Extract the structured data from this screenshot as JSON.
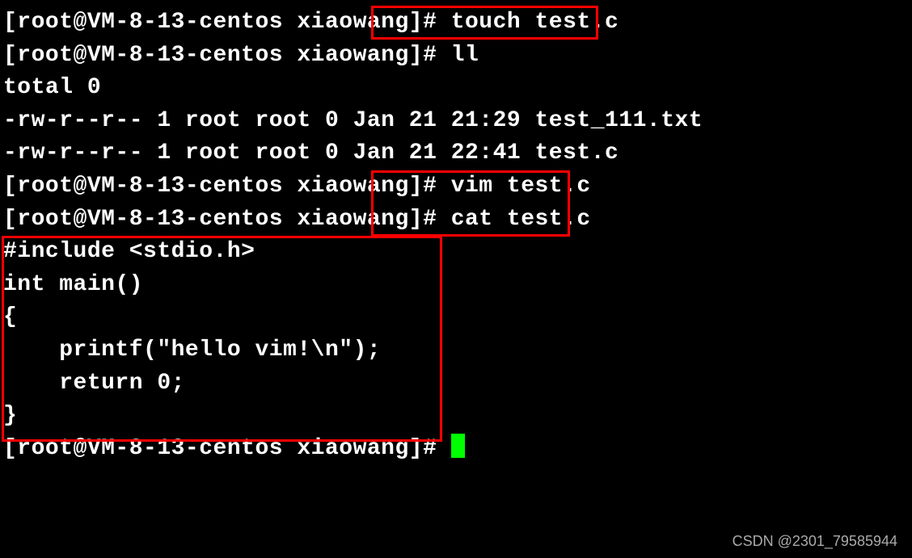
{
  "lines": {
    "l1_prompt": "[root@VM-8-13-centos xiaowang]# ",
    "l1_cmd": "touch test.c",
    "l2_prompt": "[root@VM-8-13-centos xiaowang]# ",
    "l2_cmd": "ll",
    "l3": "total 0",
    "l4": "-rw-r--r-- 1 root root 0 Jan 21 21:29 test_111.txt",
    "l5": "-rw-r--r-- 1 root root 0 Jan 21 22:41 test.c",
    "l6_prompt": "[root@VM-8-13-centos xiaowang]# ",
    "l6_cmd": "vim test.c",
    "l7_prompt": "[root@VM-8-13-centos xiaowang]# ",
    "l7_cmd": "cat test.c",
    "l8": "#include <stdio.h>",
    "l9": "",
    "l10": "int main()",
    "l11": "{",
    "l12": "    printf(\"hello vim!\\n\");",
    "l13": "    return 0;",
    "l14": "}",
    "l15_prompt": "[root@VM-8-13-centos xiaowang]# "
  },
  "watermark": "CSDN @2301_79585944"
}
